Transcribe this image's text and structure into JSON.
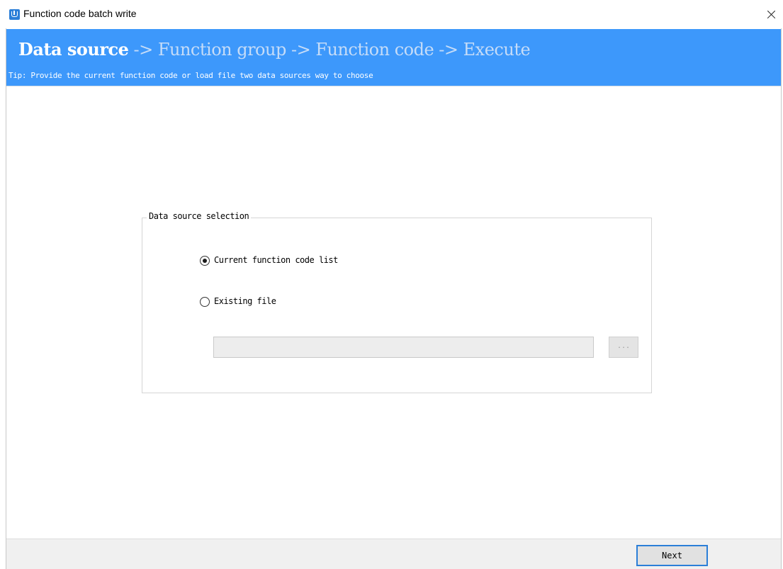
{
  "window": {
    "title": "Function code batch write",
    "icon": "app-icon"
  },
  "wizard": {
    "steps": [
      {
        "label": "Data source",
        "active": true
      },
      {
        "label": "Function group",
        "active": false
      },
      {
        "label": "Function code",
        "active": false
      },
      {
        "label": "Execute",
        "active": false
      }
    ],
    "separator": "->",
    "tip": "Tip:  Provide the current function code or load file two data sources way to choose"
  },
  "data_source": {
    "legend": "Data source selection",
    "options": [
      {
        "label": "Current function code list",
        "selected": true
      },
      {
        "label": "Existing file",
        "selected": false
      }
    ],
    "file_path": {
      "value": "",
      "placeholder": ""
    },
    "browse_label": "..."
  },
  "footer": {
    "next_label": "Next"
  },
  "colors": {
    "banner": "#3d98fb",
    "active_step": "#ffffff",
    "inactive_step": "#c5dcf8",
    "accent": "#2b7fd8"
  }
}
